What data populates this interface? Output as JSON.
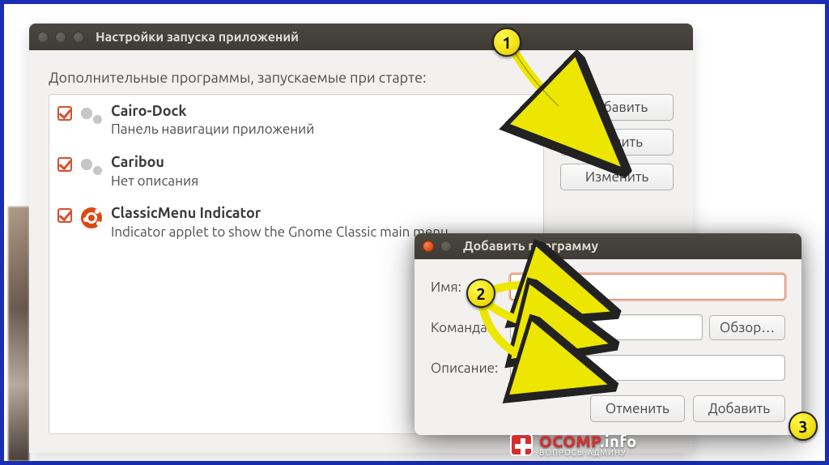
{
  "window": {
    "title": "Настройки запуска приложений",
    "section_label": "Дополнительные программы, запускаемые при старте:",
    "buttons": {
      "add": "Добавить",
      "remove": "Удалить",
      "edit": "Изменить"
    },
    "items": [
      {
        "name": "Cairo-Dock",
        "desc": "Панель навигации приложений",
        "icon": "gears"
      },
      {
        "name": "Caribou",
        "desc": "Нет описания",
        "icon": "gears"
      },
      {
        "name": "ClassicMenu Indicator",
        "desc": "Indicator applet to show the Gnome Classic main menu",
        "icon": "ubuntu"
      }
    ]
  },
  "dialog": {
    "title": "Добавить программу",
    "fields": {
      "name_label": "Имя:",
      "command_label": "Команда:",
      "description_label": "Описание:",
      "browse": "Обзор…"
    },
    "name_value": "",
    "command_value": "",
    "description_value": "",
    "actions": {
      "cancel": "Отменить",
      "add": "Добавить"
    }
  },
  "annotations": {
    "b1": "1",
    "b2": "2",
    "b3": "3"
  },
  "watermark": {
    "brand": "OCOMP",
    "suffix": ".info",
    "tagline": "ВОПРОСЫ АДМИНУ"
  }
}
